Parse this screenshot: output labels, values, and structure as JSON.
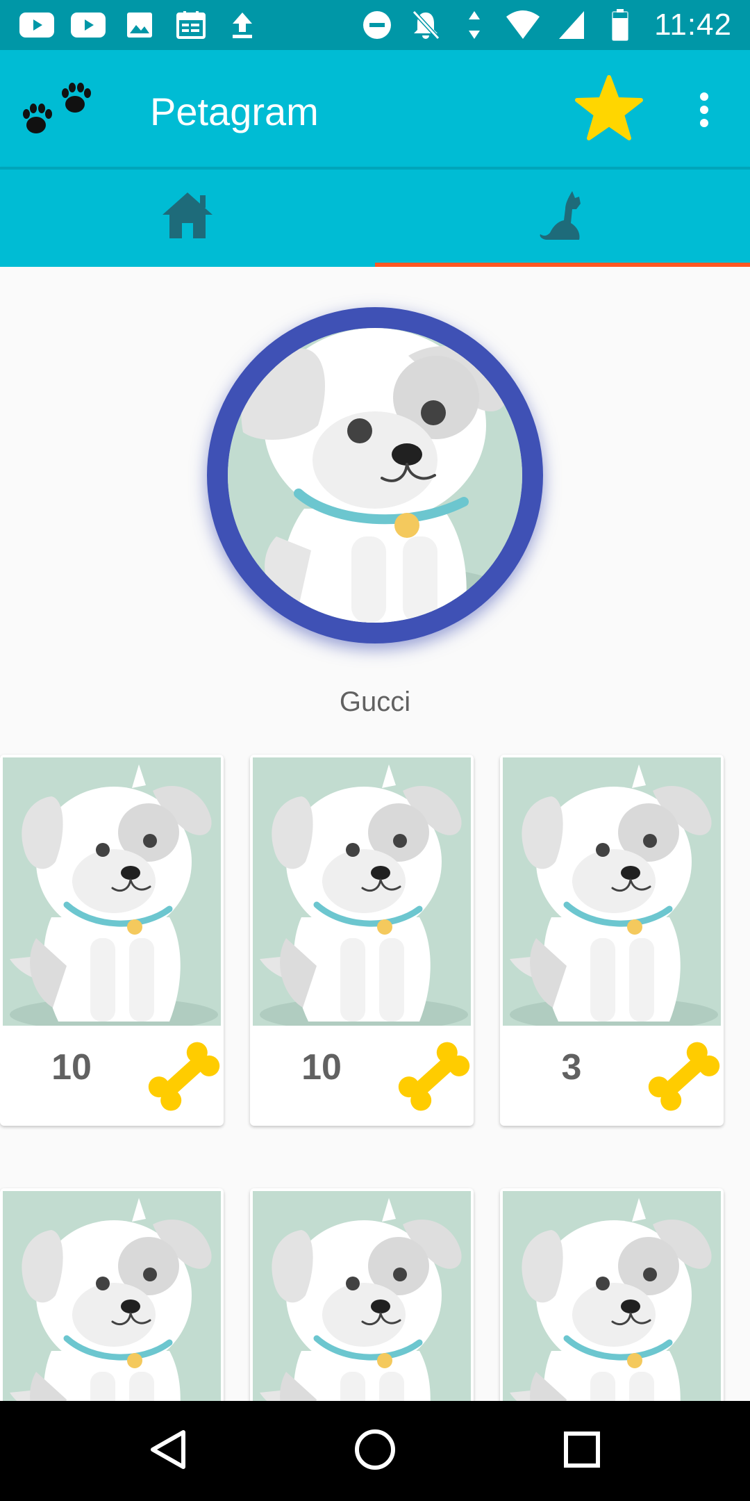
{
  "status_bar": {
    "time": "11:42",
    "left_icons": [
      "youtube-icon",
      "youtube-icon",
      "image-icon",
      "calendar-icon",
      "upload-icon"
    ],
    "right_icons": [
      "do-not-disturb-icon",
      "notifications-off-icon",
      "data-arrows-icon",
      "wifi-icon",
      "signal-icon",
      "battery-icon"
    ]
  },
  "app_bar": {
    "title": "Petagram",
    "logo_icon": "paw-prints-icon",
    "actions": [
      "star-icon",
      "overflow-menu-icon"
    ]
  },
  "tabs": {
    "items": [
      {
        "icon": "home-icon",
        "selected": false
      },
      {
        "icon": "dog-icon",
        "selected": true
      }
    ],
    "indicator_color": "#ff5722"
  },
  "profile": {
    "name": "Gucci",
    "ring_color": "#3f51b5"
  },
  "photos": [
    {
      "likes": "10",
      "icon": "bone-icon"
    },
    {
      "likes": "10",
      "icon": "bone-icon"
    },
    {
      "likes": "3",
      "icon": "bone-icon"
    },
    {
      "likes": "",
      "icon": "bone-icon"
    },
    {
      "likes": "",
      "icon": "bone-icon"
    },
    {
      "likes": "",
      "icon": "bone-icon"
    }
  ],
  "colors": {
    "primary": "#00bcd4",
    "primary_dark": "#0097a7",
    "accent": "#ff5722",
    "bone": "#ffcc00"
  },
  "nav_bar": {
    "buttons": [
      "back-icon",
      "home-circle-icon",
      "recents-icon"
    ]
  }
}
